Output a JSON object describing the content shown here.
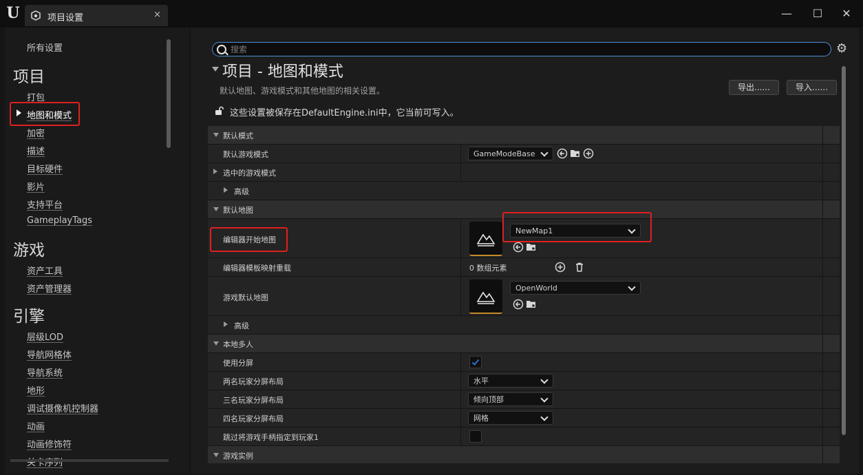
{
  "window": {
    "tab_title": "项目设置",
    "close_glyph": "×",
    "min_glyph": "—",
    "max_glyph": "☐",
    "win_close_glyph": "✕",
    "logo_text": "U"
  },
  "sidebar": {
    "all_settings": "所有设置",
    "categories": [
      {
        "label": "项目",
        "items": [
          "打包",
          "地图和模式",
          "加密",
          "描述",
          "目标硬件",
          "影片",
          "支持平台",
          "GameplayTags"
        ]
      },
      {
        "label": "游戏",
        "items": [
          "资产工具",
          "资产管理器"
        ]
      },
      {
        "label": "引擎",
        "items": [
          "层级LOD",
          "导航网格体",
          "导航系统",
          "地形",
          "调试摄像机控制器",
          "动画",
          "动画修饰符",
          "关卡序列"
        ]
      }
    ],
    "active_item": "地图和模式"
  },
  "search": {
    "placeholder": "搜索"
  },
  "page": {
    "title": "项目 - 地图和模式",
    "description": "默认地图、游戏模式和其他地图的相关设置。",
    "export_label": "导出......",
    "import_label": "导入......",
    "note": "这些设置被保存在DefaultEngine.ini中，它当前可写入。"
  },
  "settings": {
    "default_modes": {
      "section": "默认模式",
      "default_game_mode_label": "默认游戏模式",
      "default_game_mode_value": "GameModeBase",
      "selected_game_mode": "选中的游戏模式",
      "advanced": "高级"
    },
    "default_maps": {
      "section": "默认地图",
      "editor_startup_map_label": "编辑器开始地图",
      "editor_startup_map_value": "NewMap1",
      "editor_template_overrides_label": "编辑器模板映射重载",
      "editor_template_overrides_value": "0 数组元素",
      "game_default_map_label": "游戏默认地图",
      "game_default_map_value": "OpenWorld",
      "advanced": "高级"
    },
    "local_multiplayer": {
      "section": "本地多人",
      "use_splitscreen_label": "使用分屏",
      "use_splitscreen_value": true,
      "two_player_label": "两名玩家分屏布局",
      "two_player_value": "水平",
      "three_player_label": "三名玩家分屏布局",
      "three_player_value": "倾向顶部",
      "four_player_label": "四名玩家分屏布局",
      "four_player_value": "网格",
      "skip_gamepad_label": "跳过将游戏手柄指定到玩家1",
      "skip_gamepad_value": false
    },
    "game_instance": {
      "section": "游戏实例"
    }
  },
  "colors": {
    "highlight": "#e02020",
    "accent": "#4f8fd8",
    "checkbox_accent": "#2f6fd0"
  }
}
